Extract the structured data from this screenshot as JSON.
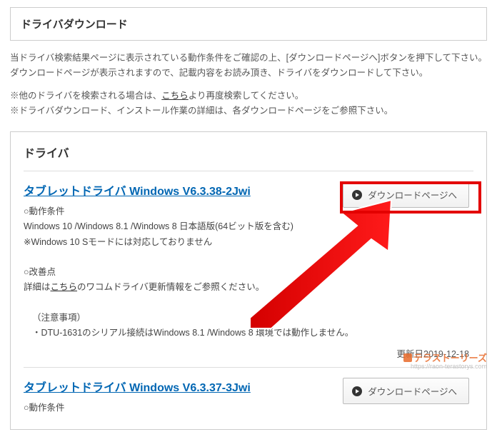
{
  "header": {
    "title": "ドライバダウンロード"
  },
  "intro": {
    "line1": "当ドライバ検索結果ページに表示されている動作条件をご確認の上、[ダウンロードページへ]ボタンを押下して下さい。",
    "line2": "ダウンロードページが表示されますので、記載内容をお読み頂き、ドライバをダウンロードして下さい。"
  },
  "notes": {
    "line1_pre": "※他のドライバを検索される場合は、",
    "line1_link": "こちら",
    "line1_post": "より再度検索してください。",
    "line2": "※ドライバダウンロード、インストール作業の詳細は、各ダウンロードページをご参照下さい。"
  },
  "section_title": "ドライバ",
  "download_button_label": "ダウンロードページへ",
  "driver1": {
    "title": "タブレットドライバ Windows V6.3.38-2Jwi",
    "cond_h": "○動作条件",
    "cond_l1": "Windows 10 /Windows 8.1 /Windows 8 日本語版(64ビット版を含む)",
    "cond_l2": "※Windows 10 Sモードには対応しておりません",
    "imp_h": "○改善点",
    "imp_pre": "詳細は",
    "imp_link": "こちら",
    "imp_post": "のワコムドライバ更新情報をご参照ください。",
    "note_h": "（注意事項）",
    "note_l1": "・DTU-1631のシリアル接続はWindows 8.1 /Windows 8 環境では動作しません。",
    "updated": "更新日2019-12-18"
  },
  "driver2": {
    "title": "タブレットドライバ Windows V6.3.37-3Jwi",
    "cond_h": "○動作条件"
  },
  "watermark": {
    "main": "テラストーリーズ",
    "sub": "https://raon-terastorys.com"
  }
}
